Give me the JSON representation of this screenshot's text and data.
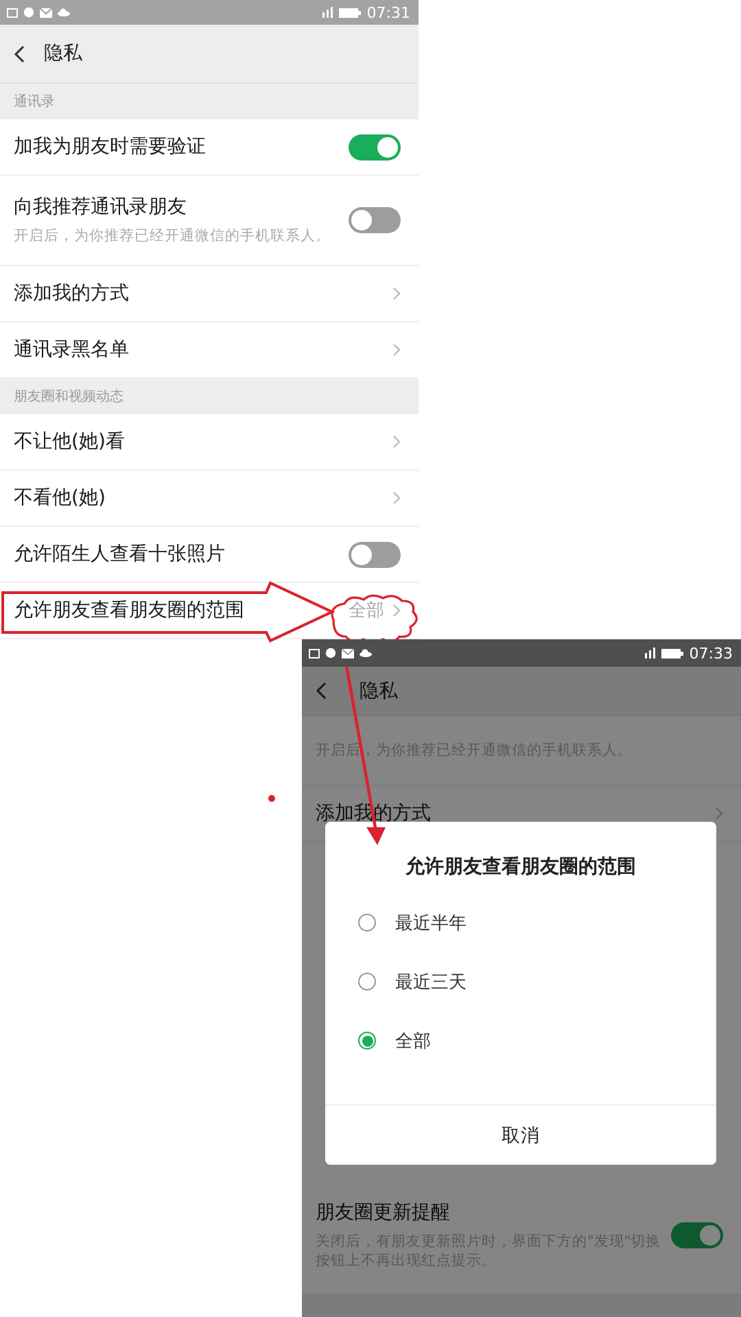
{
  "screen_1": {
    "status_bar": {
      "time": "07:31"
    },
    "title": "隐私",
    "sections": [
      {
        "header": "通讯录",
        "rows": [
          {
            "kind": "toggle",
            "label": "加我为朋友时需要验证",
            "on": true
          },
          {
            "kind": "toggle",
            "label": "向我推荐通讯录朋友",
            "on": false,
            "description": "开启后，为你推荐已经开通微信的手机联系人。"
          },
          {
            "kind": "link",
            "label": "添加我的方式"
          },
          {
            "kind": "link",
            "label": "通讯录黑名单"
          }
        ]
      },
      {
        "header": "朋友圈和视频动态",
        "rows": [
          {
            "kind": "link",
            "label": "不让他(她)看"
          },
          {
            "kind": "link",
            "label": "不看他(她)"
          },
          {
            "kind": "toggle",
            "label": "允许陌生人查看十张照片",
            "on": false
          },
          {
            "kind": "value",
            "label": "允许朋友查看朋友圈的范围",
            "value": "全部"
          }
        ]
      }
    ]
  },
  "screen_2": {
    "status_bar": {
      "time": "07:33"
    },
    "title": "隐私",
    "rows_above": [
      {
        "kind": "note",
        "description": "开启后，为你推荐已经开通微信的手机联系人。"
      },
      {
        "kind": "link",
        "label": "添加我的方式"
      }
    ],
    "rows_below": [
      {
        "kind": "toggle",
        "label": "朋友圈更新提醒",
        "on": true,
        "description": "关闭后，有朋友更新照片时，界面下方的\"发现\"切换按钮上不再出现红点提示。"
      }
    ],
    "dialog": {
      "title": "允许朋友查看朋友圈的范围",
      "options": [
        {
          "label": "最近半年",
          "selected": false
        },
        {
          "label": "最近三天",
          "selected": false
        },
        {
          "label": "全部",
          "selected": true
        }
      ],
      "button": "取消"
    }
  }
}
